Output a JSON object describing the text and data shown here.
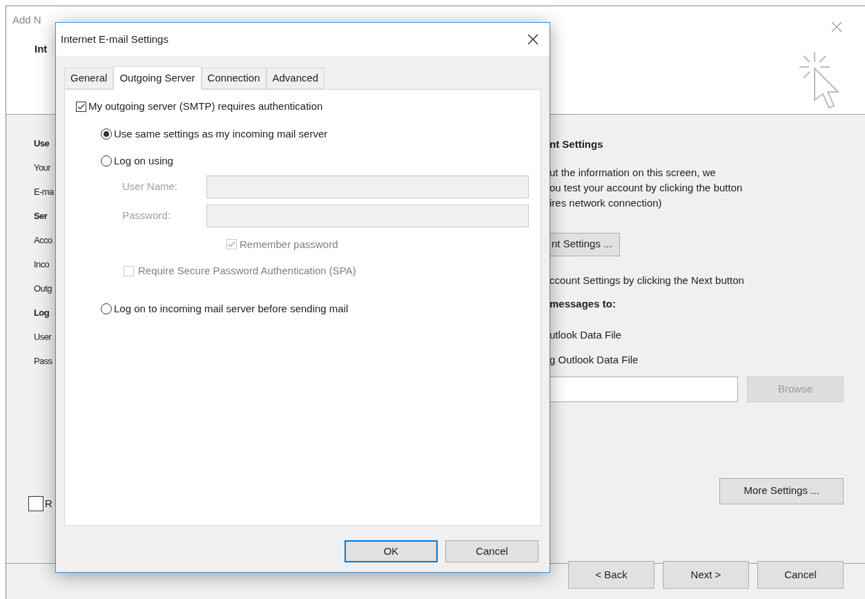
{
  "background_window": {
    "title": "Add N",
    "heading": "Int",
    "left_labels": [
      {
        "text": "Use",
        "bold": true
      },
      {
        "text": "Your",
        "bold": false
      },
      {
        "text": "E-ma",
        "bold": false
      },
      {
        "text": "Ser",
        "bold": true
      },
      {
        "text": "Acco",
        "bold": false
      },
      {
        "text": "Inco",
        "bold": false
      },
      {
        "text": "Outg",
        "bold": false
      },
      {
        "text": "Log",
        "bold": true
      },
      {
        "text": "User",
        "bold": false
      },
      {
        "text": "Pass",
        "bold": false
      }
    ],
    "remember_checkbox": {
      "label": "R",
      "checked": false
    },
    "right_heading": "nt Settings",
    "right_text": [
      "ut the information on this screen, we",
      "ou test your account by clicking the button",
      "ires network connection)"
    ],
    "test_button": "nt Settings ...",
    "next_hint": "ccount Settings by clicking the Next button",
    "deliver_heading": "messages to:",
    "deliver_options": [
      "utlook Data File",
      "g Outlook Data File"
    ],
    "browse_button": {
      "label": "Browse",
      "disabled": true
    },
    "more_settings_button": "More Settings ...",
    "buttons": [
      "< Back",
      "Next >",
      "Cancel"
    ]
  },
  "dialog": {
    "title": "Internet E-mail Settings",
    "tabs": [
      {
        "label": "General",
        "selected": false
      },
      {
        "label": "Outgoing Server",
        "selected": true
      },
      {
        "label": "Connection",
        "selected": false
      },
      {
        "label": "Advanced",
        "selected": false
      }
    ],
    "auth_checkbox": {
      "label": "My outgoing server (SMTP) requires authentication",
      "checked": true
    },
    "radios": [
      {
        "label": "Use same settings as my incoming mail server",
        "selected": true
      },
      {
        "label": "Log on using",
        "selected": false
      },
      {
        "label": "Log on to incoming mail server before sending mail",
        "selected": false
      }
    ],
    "fields": [
      {
        "label": "User Name:",
        "disabled": true
      },
      {
        "label": "Password:",
        "disabled": true
      }
    ],
    "remember_password": {
      "label": "Remember password",
      "checked": true,
      "disabled": true
    },
    "spa": {
      "label": "Require Secure Password Authentication (SPA)",
      "checked": false,
      "disabled": true
    },
    "buttons": [
      {
        "label": "OK",
        "default": true
      },
      {
        "label": "Cancel",
        "default": false
      }
    ]
  }
}
